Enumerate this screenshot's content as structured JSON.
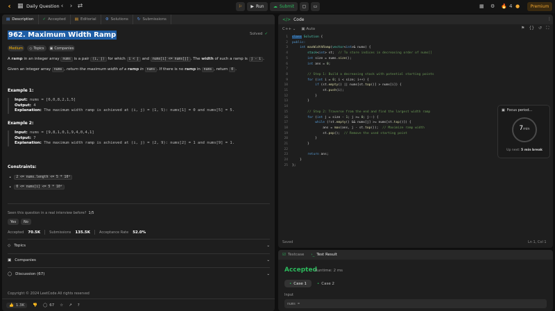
{
  "topbar": {
    "daily_label": "Daily Question",
    "run_label": "Run",
    "submit_label": "Submit",
    "streak": "4",
    "premium": "Premium"
  },
  "left_tabs": [
    {
      "label": "Description"
    },
    {
      "label": "Accepted"
    },
    {
      "label": "Editorial"
    },
    {
      "label": "Solutions"
    },
    {
      "label": "Submissions"
    }
  ],
  "problem": {
    "title": "962. Maximum Width Ramp",
    "solved": "Solved",
    "difficulty": "Medium",
    "topics_tag": "Topics",
    "companies_tag": "Companies",
    "p1a": "A ",
    "p1b": "ramp",
    "p1c": " in an integer array ",
    "p1d": "nums",
    "p1e": " is a pair ",
    "p1f": "(i, j)",
    "p1g": " for which ",
    "p1h": "i < j",
    "p1i": " and ",
    "p1j": "nums[i] <= nums[j]",
    "p1k": ". The ",
    "p1l": "width",
    "p1m": " of such a ramp is ",
    "p1n": "j - i",
    "p1o": ".",
    "p2a": "Given an integer array ",
    "p2b": "nums",
    "p2c": ", return the maximum width of a ",
    "p2d": "ramp",
    "p2e": " in ",
    "p2f": "nums",
    "p2g": ". If there is no ",
    "p2h": "ramp",
    "p2i": " in ",
    "p2j": "nums",
    "p2k": ", return ",
    "p2l": "0",
    "p2m": "."
  },
  "examples": [
    {
      "heading": "Example 1:",
      "input_label": "Input:",
      "input": "nums = [6,0,8,2,1,5]",
      "output_label": "Output:",
      "output": "4",
      "expl_label": "Explanation:",
      "explanation": "The maximum width ramp is achieved at (i, j) = (1, 5): nums[1] = 0 and nums[5] = 5."
    },
    {
      "heading": "Example 2:",
      "input_label": "Input:",
      "input": "nums = [9,8,1,0,1,9,4,0,4,1]",
      "output_label": "Output:",
      "output": "7",
      "expl_label": "Explanation:",
      "explanation": "The maximum width ramp is achieved at (i, j) = (2, 9): nums[2] = 1 and nums[9] = 1."
    }
  ],
  "constraints": {
    "heading": "Constraints:",
    "items": [
      "2 <= nums.length <= 5 * 10⁴",
      "0 <= nums[i] <= 5 * 10⁴"
    ]
  },
  "interview": {
    "question": "Seen this question in a real interview before?",
    "count": "1/5",
    "yes": "Yes",
    "no": "No"
  },
  "stats": {
    "accepted_label": "Accepted",
    "accepted": "70.5K",
    "submissions_label": "Submissions",
    "submissions": "135.5K",
    "rate_label": "Acceptance Rate",
    "rate": "52.0%"
  },
  "accordions": [
    {
      "label": "Topics"
    },
    {
      "label": "Companies"
    },
    {
      "label": "Discussion (67)"
    }
  ],
  "copyright": "Copyright © 2024 LeetCode All rights reserved",
  "footer": {
    "likes": "1.3K",
    "comments": "67"
  },
  "editor": {
    "tab": "Code",
    "language": "C++",
    "auto": "Auto",
    "saved": "Saved",
    "cursor": "Ln 1, Col 1",
    "lines": [
      "class Solution {",
      "public:",
      "    int maxWidthRamp(vector<int>& nums) {",
      "        stack<int> st;  // To store indices in decreasing order of nums[]",
      "        int size = nums.size();",
      "        int ans = 0;",
      "",
      "        // Step 1: Build a decreasing stack with potential starting points",
      "        for (int i = 0; i < size; i++) {",
      "            if (st.empty() || nums[st.top()] > nums[i]) {",
      "                st.push(i);",
      "            }",
      "        }",
      "",
      "        // Step 2: Traverse from the end and find the largest width ramp",
      "        for (int j = size - 1; j >= 0; j--) {",
      "            while (!st.empty() && nums[j] >= nums[st.top()]) {",
      "                ans = max(ans, j - st.top());  // Maximize ramp width",
      "                st.pop();  // Remove the used starting point",
      "            }",
      "        }",
      "",
      "        return ans;",
      "    }",
      "};"
    ]
  },
  "test": {
    "testcase_tab": "Testcase",
    "result_tab": "Test Result",
    "status": "Accepted",
    "runtime": "Runtime: 2 ms",
    "case1": "Case 1",
    "case2": "Case 2",
    "input_label": "Input",
    "input_value": "nums ="
  },
  "focus": {
    "title": "Focus period...",
    "minutes": "7",
    "unit": "min",
    "upnext_label": "Up next:",
    "upnext_value": "5 min break"
  },
  "colors": {
    "accent_green": "#2cbb5d",
    "medium": "#ffb800",
    "brand": "#f0a732"
  }
}
